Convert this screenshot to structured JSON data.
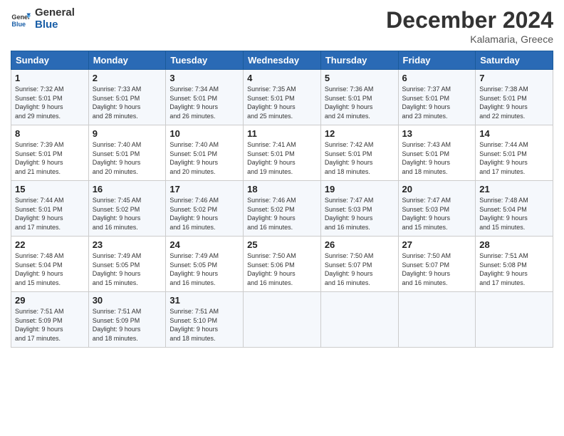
{
  "header": {
    "logo_line1": "General",
    "logo_line2": "Blue",
    "month": "December 2024",
    "location": "Kalamaria, Greece"
  },
  "days_of_week": [
    "Sunday",
    "Monday",
    "Tuesday",
    "Wednesday",
    "Thursday",
    "Friday",
    "Saturday"
  ],
  "weeks": [
    [
      {
        "day": "1",
        "detail": "Sunrise: 7:32 AM\nSunset: 5:01 PM\nDaylight: 9 hours\nand 29 minutes."
      },
      {
        "day": "2",
        "detail": "Sunrise: 7:33 AM\nSunset: 5:01 PM\nDaylight: 9 hours\nand 28 minutes."
      },
      {
        "day": "3",
        "detail": "Sunrise: 7:34 AM\nSunset: 5:01 PM\nDaylight: 9 hours\nand 26 minutes."
      },
      {
        "day": "4",
        "detail": "Sunrise: 7:35 AM\nSunset: 5:01 PM\nDaylight: 9 hours\nand 25 minutes."
      },
      {
        "day": "5",
        "detail": "Sunrise: 7:36 AM\nSunset: 5:01 PM\nDaylight: 9 hours\nand 24 minutes."
      },
      {
        "day": "6",
        "detail": "Sunrise: 7:37 AM\nSunset: 5:01 PM\nDaylight: 9 hours\nand 23 minutes."
      },
      {
        "day": "7",
        "detail": "Sunrise: 7:38 AM\nSunset: 5:01 PM\nDaylight: 9 hours\nand 22 minutes."
      }
    ],
    [
      {
        "day": "8",
        "detail": "Sunrise: 7:39 AM\nSunset: 5:01 PM\nDaylight: 9 hours\nand 21 minutes."
      },
      {
        "day": "9",
        "detail": "Sunrise: 7:40 AM\nSunset: 5:01 PM\nDaylight: 9 hours\nand 20 minutes."
      },
      {
        "day": "10",
        "detail": "Sunrise: 7:40 AM\nSunset: 5:01 PM\nDaylight: 9 hours\nand 20 minutes."
      },
      {
        "day": "11",
        "detail": "Sunrise: 7:41 AM\nSunset: 5:01 PM\nDaylight: 9 hours\nand 19 minutes."
      },
      {
        "day": "12",
        "detail": "Sunrise: 7:42 AM\nSunset: 5:01 PM\nDaylight: 9 hours\nand 18 minutes."
      },
      {
        "day": "13",
        "detail": "Sunrise: 7:43 AM\nSunset: 5:01 PM\nDaylight: 9 hours\nand 18 minutes."
      },
      {
        "day": "14",
        "detail": "Sunrise: 7:44 AM\nSunset: 5:01 PM\nDaylight: 9 hours\nand 17 minutes."
      }
    ],
    [
      {
        "day": "15",
        "detail": "Sunrise: 7:44 AM\nSunset: 5:01 PM\nDaylight: 9 hours\nand 17 minutes."
      },
      {
        "day": "16",
        "detail": "Sunrise: 7:45 AM\nSunset: 5:02 PM\nDaylight: 9 hours\nand 16 minutes."
      },
      {
        "day": "17",
        "detail": "Sunrise: 7:46 AM\nSunset: 5:02 PM\nDaylight: 9 hours\nand 16 minutes."
      },
      {
        "day": "18",
        "detail": "Sunrise: 7:46 AM\nSunset: 5:02 PM\nDaylight: 9 hours\nand 16 minutes."
      },
      {
        "day": "19",
        "detail": "Sunrise: 7:47 AM\nSunset: 5:03 PM\nDaylight: 9 hours\nand 16 minutes."
      },
      {
        "day": "20",
        "detail": "Sunrise: 7:47 AM\nSunset: 5:03 PM\nDaylight: 9 hours\nand 15 minutes."
      },
      {
        "day": "21",
        "detail": "Sunrise: 7:48 AM\nSunset: 5:04 PM\nDaylight: 9 hours\nand 15 minutes."
      }
    ],
    [
      {
        "day": "22",
        "detail": "Sunrise: 7:48 AM\nSunset: 5:04 PM\nDaylight: 9 hours\nand 15 minutes."
      },
      {
        "day": "23",
        "detail": "Sunrise: 7:49 AM\nSunset: 5:05 PM\nDaylight: 9 hours\nand 15 minutes."
      },
      {
        "day": "24",
        "detail": "Sunrise: 7:49 AM\nSunset: 5:05 PM\nDaylight: 9 hours\nand 16 minutes."
      },
      {
        "day": "25",
        "detail": "Sunrise: 7:50 AM\nSunset: 5:06 PM\nDaylight: 9 hours\nand 16 minutes."
      },
      {
        "day": "26",
        "detail": "Sunrise: 7:50 AM\nSunset: 5:07 PM\nDaylight: 9 hours\nand 16 minutes."
      },
      {
        "day": "27",
        "detail": "Sunrise: 7:50 AM\nSunset: 5:07 PM\nDaylight: 9 hours\nand 16 minutes."
      },
      {
        "day": "28",
        "detail": "Sunrise: 7:51 AM\nSunset: 5:08 PM\nDaylight: 9 hours\nand 17 minutes."
      }
    ],
    [
      {
        "day": "29",
        "detail": "Sunrise: 7:51 AM\nSunset: 5:09 PM\nDaylight: 9 hours\nand 17 minutes."
      },
      {
        "day": "30",
        "detail": "Sunrise: 7:51 AM\nSunset: 5:09 PM\nDaylight: 9 hours\nand 18 minutes."
      },
      {
        "day": "31",
        "detail": "Sunrise: 7:51 AM\nSunset: 5:10 PM\nDaylight: 9 hours\nand 18 minutes."
      },
      {
        "day": "",
        "detail": ""
      },
      {
        "day": "",
        "detail": ""
      },
      {
        "day": "",
        "detail": ""
      },
      {
        "day": "",
        "detail": ""
      }
    ]
  ]
}
